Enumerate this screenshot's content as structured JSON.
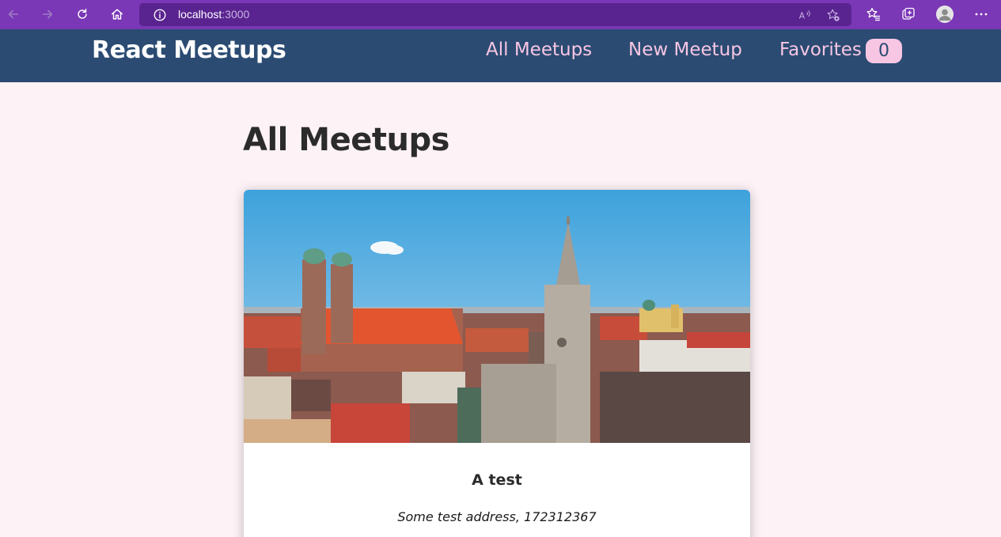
{
  "browser": {
    "url_host": "localhost",
    "url_port": ":3000",
    "colors": {
      "frame": "#7a37b6",
      "address_bar": "#5a2490"
    },
    "icons": [
      "back-arrow-icon",
      "forward-arrow-icon",
      "reload-icon",
      "home-icon",
      "info-icon",
      "read-aloud-icon",
      "add-favorite-icon",
      "favorites-icon",
      "collections-icon",
      "profile-avatar",
      "more-options-icon"
    ]
  },
  "header": {
    "logo": "React Meetups",
    "nav": {
      "all_meetups": "All Meetups",
      "new_meetup": "New Meetup",
      "favorites": "Favorites"
    },
    "favorites_count": "0",
    "colors": {
      "background": "#2b4b72",
      "link": "#f7c6e3",
      "logo": "#ffffff"
    }
  },
  "main": {
    "title": "All Meetups",
    "meetups": [
      {
        "title": "A test",
        "address": "Some test address, 172312367",
        "image": "munich-city-skyline-image"
      }
    ]
  },
  "colors": {
    "page_background": "#fdf2f6"
  }
}
